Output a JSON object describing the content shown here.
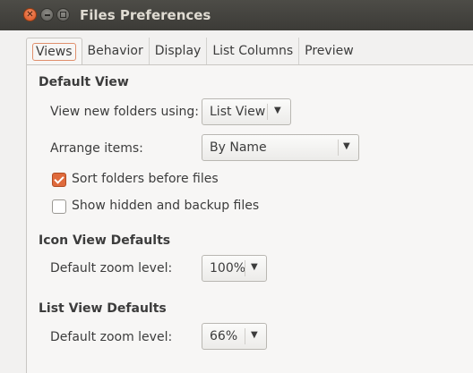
{
  "window": {
    "title": "Files Preferences"
  },
  "tabs": [
    {
      "label": "Views"
    },
    {
      "label": "Behavior"
    },
    {
      "label": "Display"
    },
    {
      "label": "List Columns"
    },
    {
      "label": "Preview"
    }
  ],
  "default_view": {
    "heading": "Default View",
    "view_new_folders": {
      "label": "View new folders using:",
      "value": "List View"
    },
    "arrange_items": {
      "label": "Arrange items:",
      "value": "By Name"
    },
    "sort_folders": {
      "label": "Sort folders before files",
      "checked": true
    },
    "show_hidden": {
      "label": "Show hidden and backup files",
      "checked": false
    }
  },
  "icon_view": {
    "heading": "Icon View Defaults",
    "zoom": {
      "label": "Default zoom level:",
      "value": "100%"
    }
  },
  "list_view": {
    "heading": "List View Defaults",
    "zoom": {
      "label": "Default zoom level:",
      "value": "66%"
    }
  },
  "colors": {
    "accent": "#df6a3c",
    "titlebar": "#3c3b37"
  }
}
